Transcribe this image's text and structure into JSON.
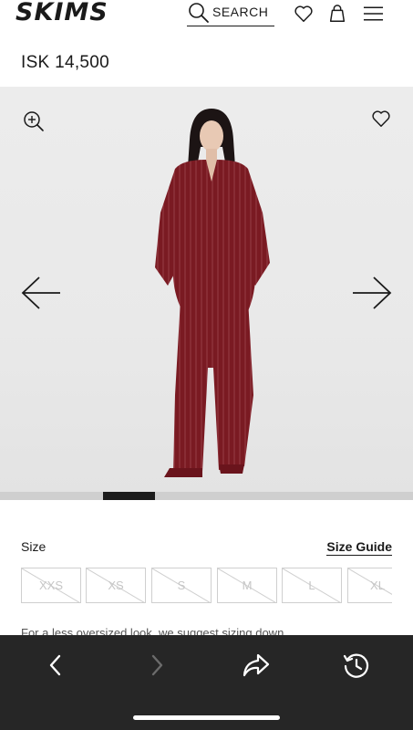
{
  "header": {
    "brand": "SKIMS",
    "search_label": "SEARCH",
    "icons": [
      "search-icon",
      "heart-icon",
      "bag-icon",
      "menu-icon"
    ]
  },
  "product": {
    "price": "ISK 14,500",
    "image_alt": "Woman wearing burgundy pinstripe long-sleeve button-up pajama shirt and wide-leg pajama pants",
    "gallery": {
      "active_index": 2,
      "progress_fraction": 0.125
    }
  },
  "size_section": {
    "label": "Size",
    "guide_label": "Size Guide",
    "sizes": [
      {
        "label": "XXS",
        "available": false
      },
      {
        "label": "XS",
        "available": false
      },
      {
        "label": "S",
        "available": false
      },
      {
        "label": "M",
        "available": false
      },
      {
        "label": "L",
        "available": false
      },
      {
        "label": "XL",
        "available": false
      }
    ],
    "note": "For a less oversized look, we suggest sizing down"
  },
  "browser_toolbar": {
    "icons": [
      "back-icon",
      "forward-icon",
      "share-icon",
      "history-icon"
    ],
    "forward_enabled": false
  },
  "colors": {
    "product": "#7a1a22",
    "toolbar_bg": "#262626",
    "disabled": "#c6c6c6"
  }
}
